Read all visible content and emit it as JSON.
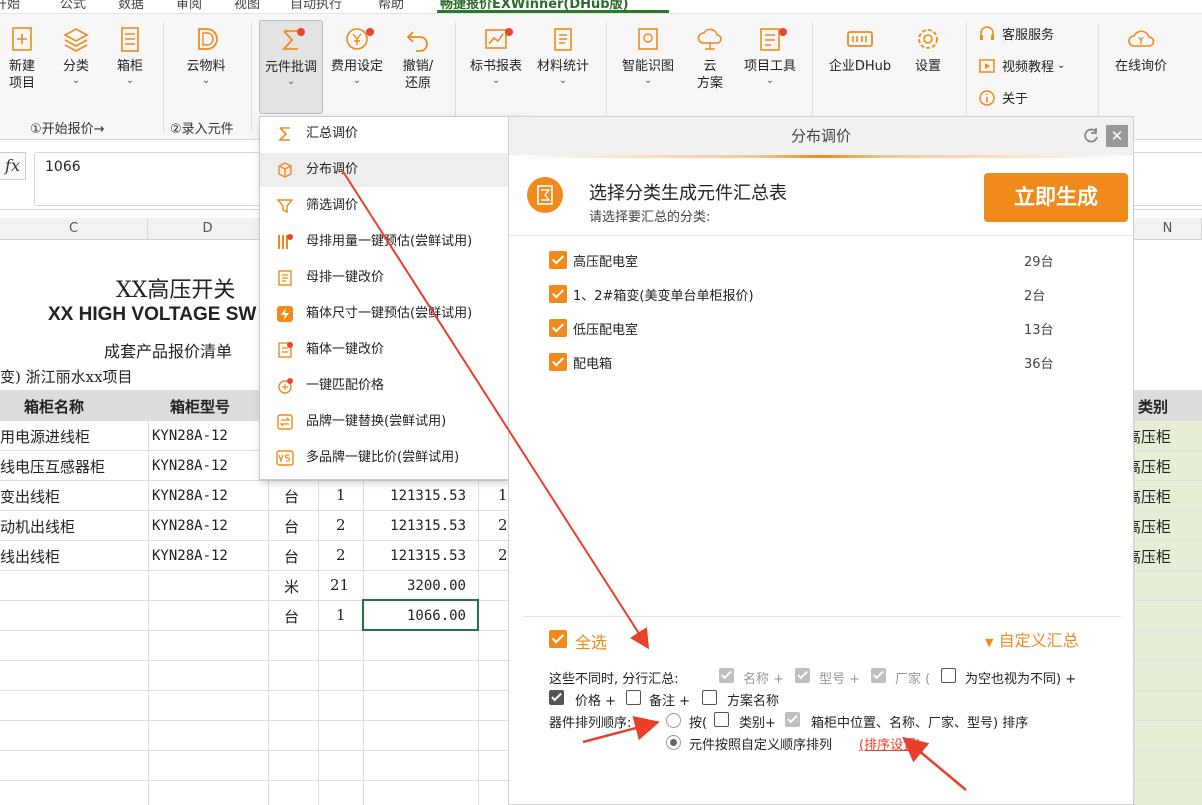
{
  "ribbon_tabs": [
    "开始",
    "公式",
    "数据",
    "审阅",
    "视图",
    "自动执行",
    "帮助",
    "畅捷报价EXWinner(DHub版)"
  ],
  "ribbon": {
    "buttons": [
      {
        "label": "新建\n项目"
      },
      {
        "label": "分类"
      },
      {
        "label": "箱柜"
      },
      {
        "label": "云物料"
      },
      {
        "label": "元件批调"
      },
      {
        "label": "费用设定"
      },
      {
        "label": "撤销/\n还原"
      },
      {
        "label": "标书报表"
      },
      {
        "label": "材料统计"
      },
      {
        "label": "智能识图"
      },
      {
        "label": "云\n方案"
      },
      {
        "label": "项目工具"
      },
      {
        "label": "企业DHub"
      },
      {
        "label": "设置"
      },
      {
        "label": "在线询价"
      }
    ],
    "side": {
      "service": "客服服务",
      "video": "视频教程",
      "about": "关于"
    },
    "groups": {
      "start": "①开始报价→",
      "enter": "②录入元件"
    }
  },
  "formula_bar": {
    "fx": "fx",
    "value": "1066"
  },
  "columns": [
    "C",
    "D",
    "N"
  ],
  "sheet": {
    "title_cn": "XX高压开关",
    "title_en": "XX HIGH VOLTAGE SW",
    "subtitle": "成套产品报价清单",
    "project": "变) 浙江丽水xx项目",
    "header": {
      "name": "箱柜名称",
      "model": "箱柜型号",
      "category": "类别"
    },
    "rows": [
      {
        "name": "用电源进线柜",
        "model": "KYN28A-12",
        "unit": "",
        "qty": "",
        "price": "",
        "cat": "高压柜"
      },
      {
        "name": "线电压互感器柜",
        "model": "KYN28A-12",
        "unit": "",
        "qty": "",
        "price": "",
        "cat": "高压柜"
      },
      {
        "name": "变出线柜",
        "model": "KYN28A-12",
        "unit": "台",
        "qty": "1",
        "price": "121315.53",
        "cat": "高压柜"
      },
      {
        "name": "动机出线柜",
        "model": "KYN28A-12",
        "unit": "台",
        "qty": "2",
        "price": "121315.53",
        "cat": "高压柜"
      },
      {
        "name": "线出线柜",
        "model": "KYN28A-12",
        "unit": "台",
        "qty": "2",
        "price": "121315.53",
        "cat": "高压柜"
      },
      {
        "name": "",
        "model": "",
        "unit": "米",
        "qty": "21",
        "price": "3200.00",
        "cat": ""
      },
      {
        "name": "",
        "model": "",
        "unit": "台",
        "qty": "1",
        "price": "1066.00",
        "cat": ""
      }
    ],
    "sub_values": [
      "1",
      "2",
      "2"
    ]
  },
  "dropdown": {
    "items": [
      "汇总调价",
      "分布调价",
      "筛选调价",
      "母排用量一键预估(尝鲜试用)",
      "母排一键改价",
      "箱体尺寸一键预估(尝鲜试用)",
      "箱体一键改价",
      "一键匹配价格",
      "品牌一键替换(尝鲜试用)",
      "多品牌一键比价(尝鲜试用)"
    ]
  },
  "panel": {
    "title": "分布调价",
    "heading": "选择分类生成元件汇总表",
    "subheading": "请选择要汇总的分类:",
    "generate": "立即生成",
    "categories": [
      {
        "name": "高压配电室",
        "count": "29台"
      },
      {
        "name": "1、2#箱变(美变单台单柜报价)",
        "count": "2台"
      },
      {
        "name": "低压配电室",
        "count": "13台"
      },
      {
        "name": "配电箱",
        "count": "36台"
      }
    ],
    "select_all": "全选",
    "custom_summary": "自定义汇总",
    "diff_label": "这些不同时, 分行汇总:",
    "diff_name": "名称 +",
    "diff_model": "型号 +",
    "diff_maker": "厂家 (",
    "diff_empty": "为空也视为不同) +",
    "diff_price": "价格 +",
    "diff_note": "备注 +",
    "diff_plan": "方案名称",
    "sort_label": "器件排列顺序:",
    "sort_by": "按(",
    "sort_cat": "类别+",
    "sort_pos": "箱柜中位置、名称、厂家、型号) 排序",
    "sort_custom": "元件按照自定义顺序排列",
    "sort_settings": "(排序设置)"
  },
  "colors": {
    "accent": "#ef8a1b",
    "arrow": "#e8402a",
    "green": "#2a7a2a"
  }
}
